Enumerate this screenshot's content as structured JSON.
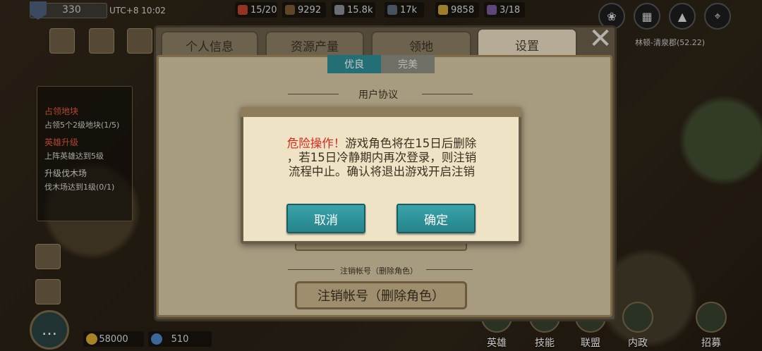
{
  "topbar": {
    "level": "330",
    "utc": "UTC+8 10:02",
    "resources": [
      {
        "name": "troops",
        "value": "15/20",
        "color": "#c0402b",
        "icon": "troop-icon"
      },
      {
        "name": "wood",
        "value": "9292",
        "color": "#7a5a32",
        "icon": "wood-icon"
      },
      {
        "name": "stone",
        "value": "15.8k",
        "color": "#8a8f94",
        "icon": "stone-icon"
      },
      {
        "name": "iron",
        "value": "17k",
        "color": "#5a6a7a",
        "icon": "iron-icon"
      },
      {
        "name": "grain",
        "value": "9858",
        "color": "#c8a235",
        "icon": "grain-icon"
      },
      {
        "name": "queue",
        "value": "3/18",
        "color": "#7a5a9a",
        "icon": "queue-icon"
      }
    ],
    "coordinate": "林顿-清泉郡(52.22)"
  },
  "quests": [
    {
      "title": "占领地块",
      "desc": "占领5个2级地块(1/5)",
      "highlight": true
    },
    {
      "title": "英雄升级",
      "desc": "上阵英雄达到5级",
      "highlight": true
    },
    {
      "title": "升级伐木场",
      "desc": "伐木场达到1级(0/1)",
      "highlight": false
    }
  ],
  "bottom": {
    "gold": "58000",
    "gems": "510",
    "nav": [
      "英雄",
      "技能",
      "联盟",
      "内政",
      "招募"
    ]
  },
  "modal": {
    "tabs": [
      "个人信息",
      "资源产量",
      "领地",
      "设置"
    ],
    "active_tab": "设置",
    "close": "✕",
    "quality_options": [
      "优良",
      "完美"
    ],
    "section_user_agreement": "用户协议",
    "section_delete_account": "注销帐号（删除角色）",
    "delete_button": "注销帐号（删除角色）"
  },
  "dialog": {
    "danger_prefix": "危险操作！",
    "message_line1": "游戏角色将在15日后删除",
    "message_line2": "，若15日冷静期内再次登录，则注销",
    "message_line3": "流程中止。确认将退出游戏开启注销",
    "cancel": "取消",
    "confirm": "确定"
  }
}
